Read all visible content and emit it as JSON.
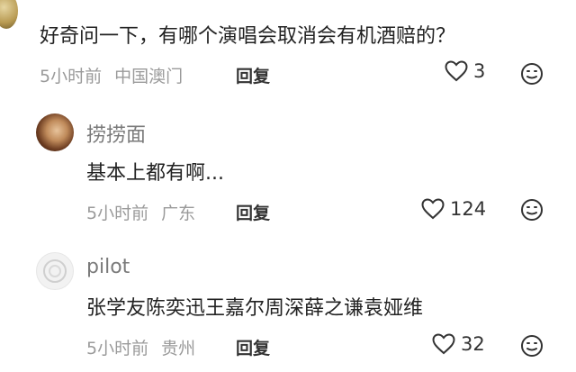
{
  "comments": [
    {
      "text": "好奇问一下，有哪个演唱会取消会有机酒赔的？",
      "time": "5小时前",
      "location": "中国澳门",
      "reply_label": "回复",
      "likes": "3"
    },
    {
      "username": "捞捞面",
      "text": "基本上都有啊...",
      "time": "5小时前",
      "location": "广东",
      "reply_label": "回复",
      "likes": "124"
    },
    {
      "username": "pilot",
      "text": "张学友陈奕迅王嘉尔周深薛之谦袁娅维",
      "time": "5小时前",
      "location": "贵州",
      "reply_label": "回复",
      "likes": "32"
    }
  ],
  "icons": {
    "like": "heart-outline-icon",
    "emoji": "smiley-icon"
  }
}
